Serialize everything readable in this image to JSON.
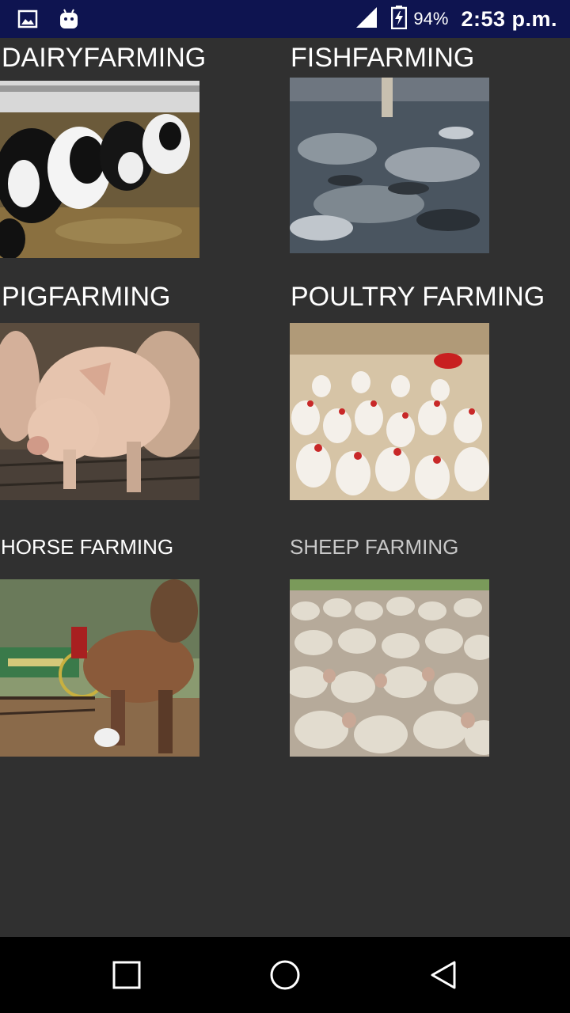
{
  "status_bar": {
    "battery_percent": "94%",
    "time": "2:53 p.m.",
    "icons": [
      "gallery-icon",
      "android-icon",
      "signal-icon",
      "battery-charging-icon"
    ]
  },
  "tiles": [
    {
      "label": "DAIRYFARMING",
      "image": "dairy-cows-photo"
    },
    {
      "label": "FISHFARMING",
      "image": "fish-pond-photo"
    },
    {
      "label": "PIGFARMING",
      "image": "pig-photo"
    },
    {
      "label": "POULTRY FARMING",
      "image": "chickens-photo"
    },
    {
      "label": "HORSE FARMING",
      "image": "horse-photo"
    },
    {
      "label": "SHEEP FARMING",
      "image": "sheep-flock-photo"
    }
  ],
  "nav_bar": {
    "icons": [
      "recents-square-icon",
      "home-circle-icon",
      "back-triangle-icon"
    ]
  },
  "colors": {
    "status_bar_bg": "#0e1450",
    "content_bg": "#303030",
    "nav_bar_bg": "#000000",
    "label_text": "#ffffff"
  }
}
